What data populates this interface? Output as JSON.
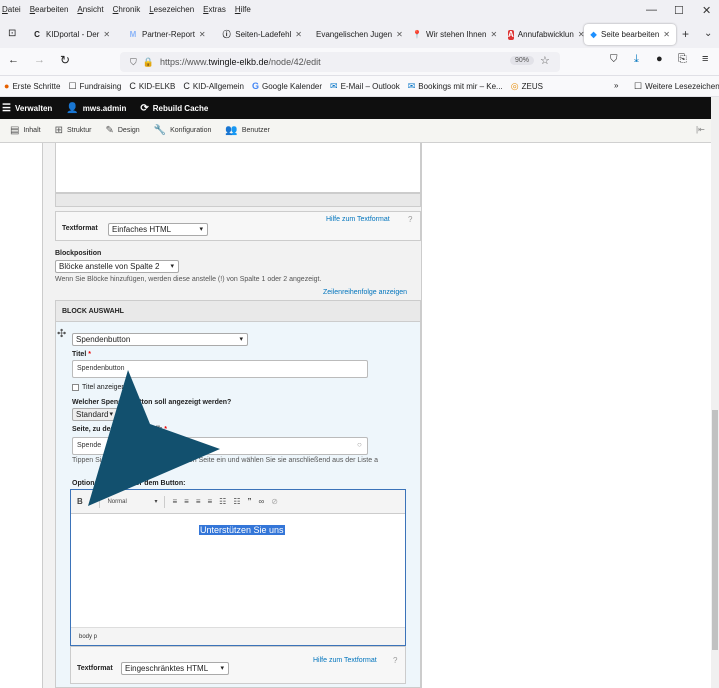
{
  "menubar": [
    "Datei",
    "Bearbeiten",
    "Ansicht",
    "Chronik",
    "Lesezeichen",
    "Extras",
    "Hilfe"
  ],
  "window_controls": {
    "minimize": "—",
    "maximize": "☐",
    "close": "✕"
  },
  "tabs": [
    {
      "icon": "C",
      "label": "KIDportal - Der"
    },
    {
      "icon": "M",
      "label": "Partner-Report"
    },
    {
      "icon": "ⓘ",
      "label": "Seiten-Ladefehl"
    },
    {
      "icon": "",
      "label": "Evangelischen Jugen"
    },
    {
      "icon": "📍",
      "label": "Wir stehen Ihnen"
    },
    {
      "icon": "A",
      "label": "Annufabwicklun"
    },
    {
      "icon": "◆",
      "label": "Seite bearbeiten"
    }
  ],
  "url": {
    "prefix": "https://www.",
    "domain": "twingle-elkb.de",
    "path": "/node/42/edit",
    "zoom": "90%"
  },
  "bookmarks": [
    {
      "icon": "●",
      "label": "Erste Schritte"
    },
    {
      "icon": "☐",
      "label": "Fundraising"
    },
    {
      "icon": "C",
      "label": "KID-ELKB"
    },
    {
      "icon": "C",
      "label": "KID-Allgemein"
    },
    {
      "icon": "G",
      "label": "Google Kalender"
    },
    {
      "icon": "✉",
      "label": "E-Mail – Outlook"
    },
    {
      "icon": "✉",
      "label": "Bookings mit mir – Ke..."
    },
    {
      "icon": "◎",
      "label": "ZEUS"
    }
  ],
  "bookmarks_more": "Weitere Lesezeichen",
  "toolbar": {
    "manage": "Verwalten",
    "user": "mws.admin",
    "rebuild": "Rebuild Cache"
  },
  "tray": [
    "Inhalt",
    "Struktur",
    "Design",
    "Konfiguration",
    "Benutzer"
  ],
  "form": {
    "textformat_label": "Textformat",
    "textformat_value": "Einfaches HTML",
    "textformat_help": "Hilfe zum Textformat",
    "blockposition_label": "Blockposition",
    "blockposition_value": "Blöcke anstelle von Spalte 2",
    "blockposition_desc": "Wenn Sie Blöcke hinzufügen, werden diese anstelle (!) von Spalte 1 oder 2 angezeigt.",
    "row_weights_link": "Zeilenreihenfolge anzeigen",
    "block_header": "BLOCK AUSWAHL",
    "block_type": "Spendenbutton",
    "title_label": "Titel",
    "title_value": "Spendenbutton",
    "show_title": "Titel anzeigen",
    "which_label": "Welcher Spendenbutton soll angezeigt werden?",
    "which_value": "Standard",
    "link_label": "Seite, zu der verlinken soll:",
    "link_value": "Spende",
    "link_desc": "Tippen Sie den Titel der zu verlinkenden Seite ein und wählen Sie sie anschließend aus der Liste a",
    "optional_label": "Optionaler Text unter dem Button:",
    "editor_format": "Normal",
    "editor_text": "Unterstützen Sie uns",
    "editor_path": "body  p",
    "textformat2_label": "Textformat",
    "textformat2_value": "Eingeschränktes HTML",
    "textformat2_help": "Hilfe zum Textformat"
  }
}
